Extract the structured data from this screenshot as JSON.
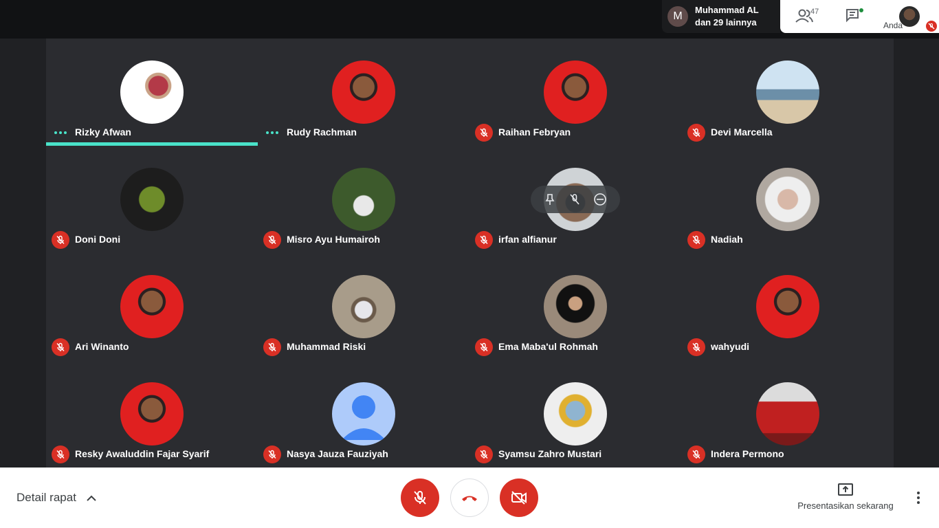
{
  "header": {
    "presenter": {
      "initial": "M",
      "line1": "Muhammad AL",
      "line2": "dan 29 lainnya"
    },
    "people_count": "47",
    "self_label": "Anda"
  },
  "participants": [
    {
      "name": "Rizky Afwan",
      "status": "speaking",
      "avatar": "photo-white"
    },
    {
      "name": "Rudy Rachman",
      "status": "speaking",
      "avatar": "photo-red"
    },
    {
      "name": "Raihan Febryan",
      "status": "muted",
      "avatar": "photo-red"
    },
    {
      "name": "Devi Marcella",
      "status": "muted",
      "avatar": "photo-beach"
    },
    {
      "name": "Doni Doni",
      "status": "muted",
      "avatar": "photo-dark-logo"
    },
    {
      "name": "Misro Ayu Humairoh",
      "status": "muted",
      "avatar": "photo-forest"
    },
    {
      "name": "irfan alfianur",
      "status": "muted",
      "avatar": "photo-mask"
    },
    {
      "name": "Nadiah",
      "status": "muted",
      "avatar": "photo-hijab"
    },
    {
      "name": "Ari Winanto",
      "status": "muted",
      "avatar": "photo-red"
    },
    {
      "name": "Muhammad Riski",
      "status": "muted",
      "avatar": "photo-outdoor"
    },
    {
      "name": "Ema Maba'ul Rohmah",
      "status": "muted",
      "avatar": "photo-hijab-dark"
    },
    {
      "name": "wahyudi",
      "status": "muted",
      "avatar": "photo-red"
    },
    {
      "name": "Resky Awaluddin Fajar Syarif",
      "status": "muted",
      "avatar": "photo-red"
    },
    {
      "name": "Nasya Jauza Fauziyah",
      "status": "muted",
      "avatar": "default-person-icon"
    },
    {
      "name": "Syamsu Zahro Mustari",
      "status": "muted",
      "avatar": "photo-faceshield"
    },
    {
      "name": "Indera Permono",
      "status": "muted",
      "avatar": "photo-sofa"
    }
  ],
  "footer": {
    "details_label": "Detail rapat",
    "present_label": "Presentasikan sekarang"
  },
  "colors": {
    "accent_speaking": "#4ae3c9",
    "mute_red": "#d93025",
    "grid_bg": "#2b2c30"
  }
}
